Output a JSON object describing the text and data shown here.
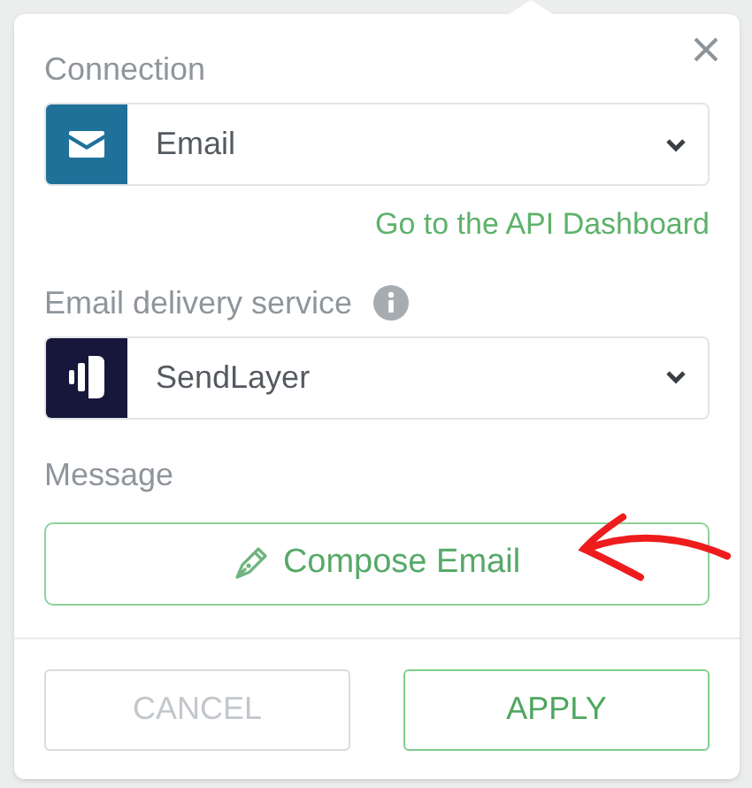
{
  "connection": {
    "label": "Connection",
    "value": "Email"
  },
  "dashboard_link": "Go to the API Dashboard",
  "delivery_service": {
    "label": "Email delivery service",
    "value": "SendLayer"
  },
  "message": {
    "label": "Message",
    "button": "Compose Email"
  },
  "buttons": [
    {
      "label": "CANCEL",
      "kind": "secondary",
      "disabled": true
    },
    {
      "label": "APPLY",
      "kind": "primary",
      "disabled": false
    }
  ]
}
